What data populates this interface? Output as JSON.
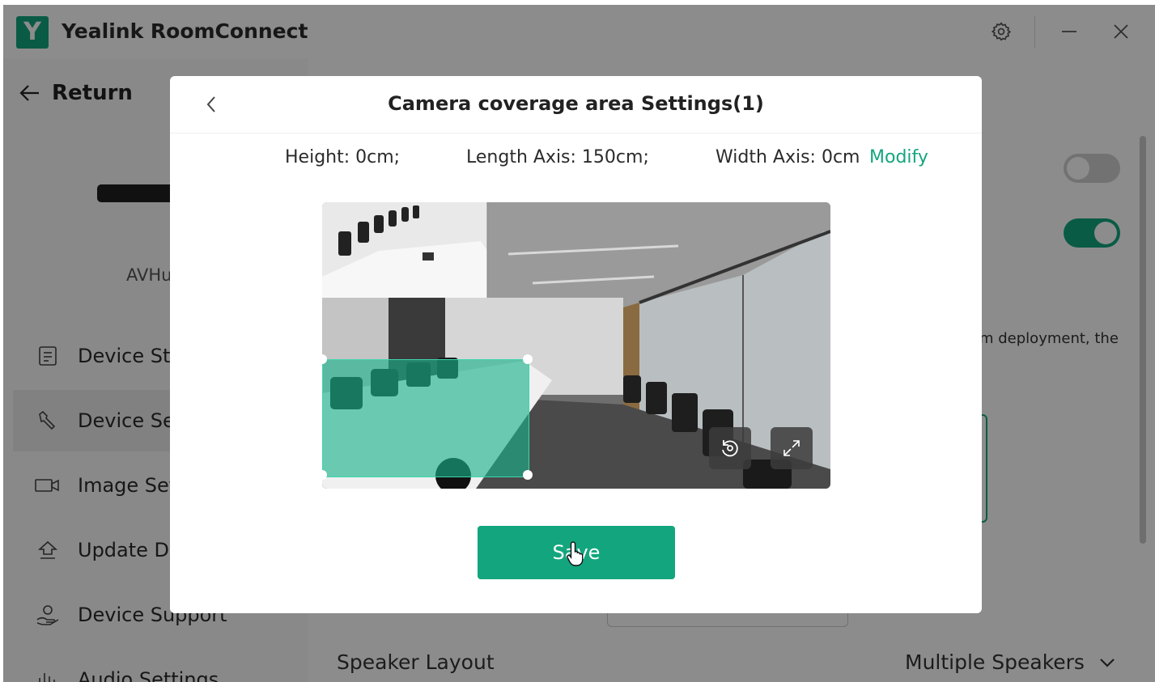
{
  "app": {
    "title": "Yealink RoomConnect",
    "logo_letter": "Y",
    "accent": "#13a67e"
  },
  "window": {
    "settings_icon": "gear-icon",
    "minimize_icon": "minimize-icon",
    "close_icon": "close-icon"
  },
  "sidebar": {
    "return_label": "Return",
    "device_name": "AVHu",
    "items": [
      {
        "label": "Device Sta",
        "icon": "document-icon"
      },
      {
        "label": "Device Set",
        "icon": "wrench-icon",
        "active": true
      },
      {
        "label": "Image Set",
        "icon": "camera-icon"
      },
      {
        "label": "Update De",
        "icon": "upload-icon"
      },
      {
        "label": "Device Support",
        "icon": "support-icon"
      },
      {
        "label": "Audio Settings",
        "icon": "equalizer-icon"
      }
    ]
  },
  "main": {
    "toggle1": {
      "state": "off"
    },
    "toggle2": {
      "state": "on"
    },
    "description_fragment": "m deployment, the",
    "speaker_layout_label": "Speaker Layout",
    "speaker_layout_value": "Multiple Speakers"
  },
  "modal": {
    "title": "Camera coverage area Settings(1)",
    "height": "Height: 0cm;",
    "length_axis": "Length Axis: 150cm;",
    "width_axis": "Width Axis: 0cm",
    "modify_label": "Modify",
    "save_label": "Save",
    "reset_icon": "reset-icon",
    "fullscreen_icon": "fullscreen-icon"
  }
}
